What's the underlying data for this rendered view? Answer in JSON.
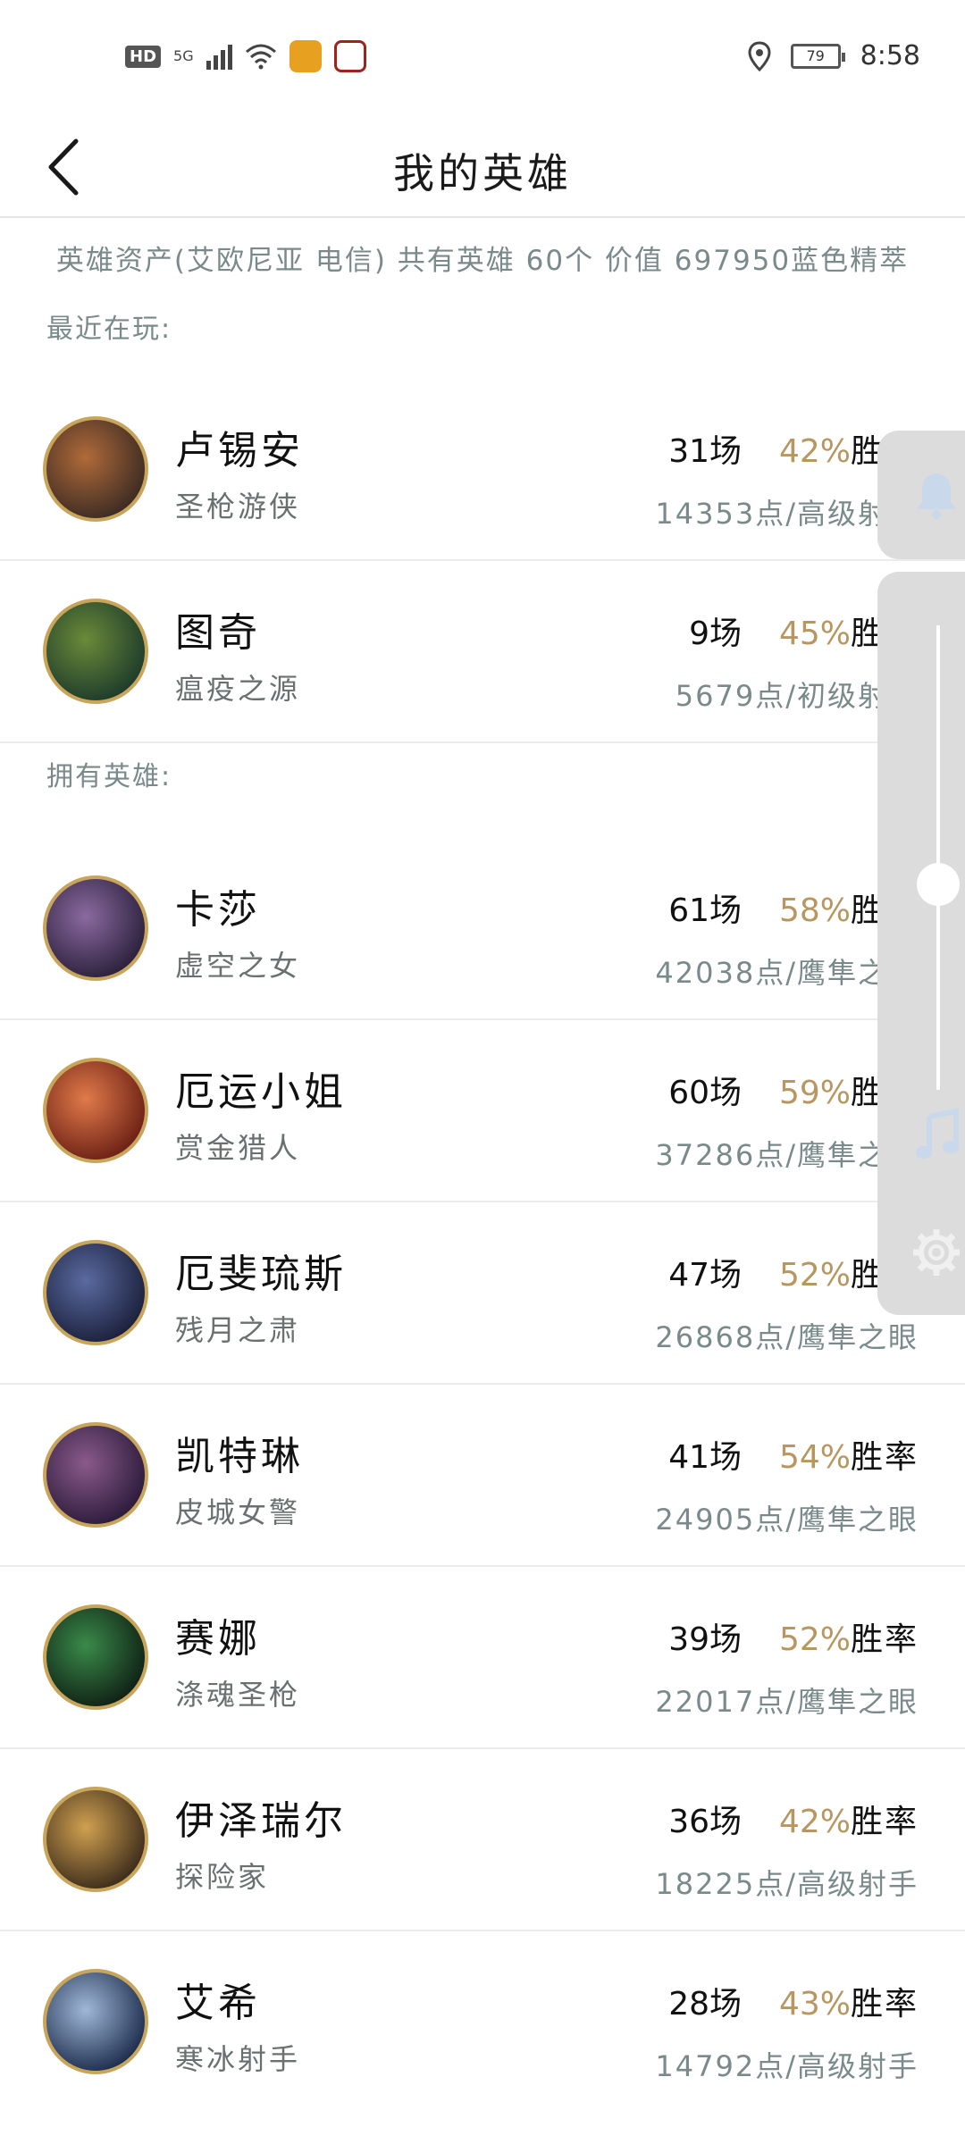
{
  "status_bar": {
    "hd_label": "HD",
    "network_label": "5G",
    "battery_level": "79",
    "time": "8:58"
  },
  "header": {
    "title": "我的英雄",
    "back_icon": "chevron-left-icon"
  },
  "summary": "英雄资产(艾欧尼亚 电信) 共有英雄 60个 价值 697950蓝色精萃",
  "recent_label": "最近在玩:",
  "owned_label": "拥有英雄:",
  "winrate_suffix": "胜率",
  "recent": [
    {
      "name": "卢锡安",
      "title": "圣枪游侠",
      "games": "31场",
      "pct": "42%",
      "points": "14353点/高级射手",
      "colors": [
        "#3a2a22",
        "#b06a3a"
      ]
    },
    {
      "name": "图奇",
      "title": "瘟疫之源",
      "games": "9场",
      "pct": "45%",
      "points": "5679点/初级射手",
      "colors": [
        "#1c3a2a",
        "#6a8a3a"
      ]
    }
  ],
  "owned": [
    {
      "name": "卡莎",
      "title": "虚空之女",
      "games": "61场",
      "pct": "58%",
      "points": "42038点/鹰隼之眼",
      "colors": [
        "#2a1f3a",
        "#8a6aa0"
      ]
    },
    {
      "name": "厄运小姐",
      "title": "赏金猎人",
      "games": "60场",
      "pct": "59%",
      "points": "37286点/鹰隼之眼",
      "colors": [
        "#6a1f14",
        "#e07a4a"
      ]
    },
    {
      "name": "厄斐琉斯",
      "title": "残月之肃",
      "games": "47场",
      "pct": "52%",
      "points": "26868点/鹰隼之眼",
      "colors": [
        "#1a1f3a",
        "#5a6aa0"
      ]
    },
    {
      "name": "凯特琳",
      "title": "皮城女警",
      "games": "41场",
      "pct": "54%",
      "points": "24905点/鹰隼之眼",
      "colors": [
        "#2a1a3a",
        "#8a5a8a"
      ]
    },
    {
      "name": "赛娜",
      "title": "涤魂圣枪",
      "games": "39场",
      "pct": "52%",
      "points": "22017点/鹰隼之眼",
      "colors": [
        "#0f1f14",
        "#3a8a4a"
      ]
    },
    {
      "name": "伊泽瑞尔",
      "title": "探险家",
      "games": "36场",
      "pct": "42%",
      "points": "18225点/高级射手",
      "colors": [
        "#3a2a1a",
        "#d0a050"
      ]
    },
    {
      "name": "艾希",
      "title": "寒冰射手",
      "games": "28场",
      "pct": "43%",
      "points": "14792点/高级射手",
      "colors": [
        "#1a2a4a",
        "#a0b8d8"
      ]
    }
  ],
  "side_panel": {
    "icons": [
      "bell-icon",
      "music-note-icon",
      "settings-gear-icon"
    ],
    "slider_level": 0.5
  }
}
